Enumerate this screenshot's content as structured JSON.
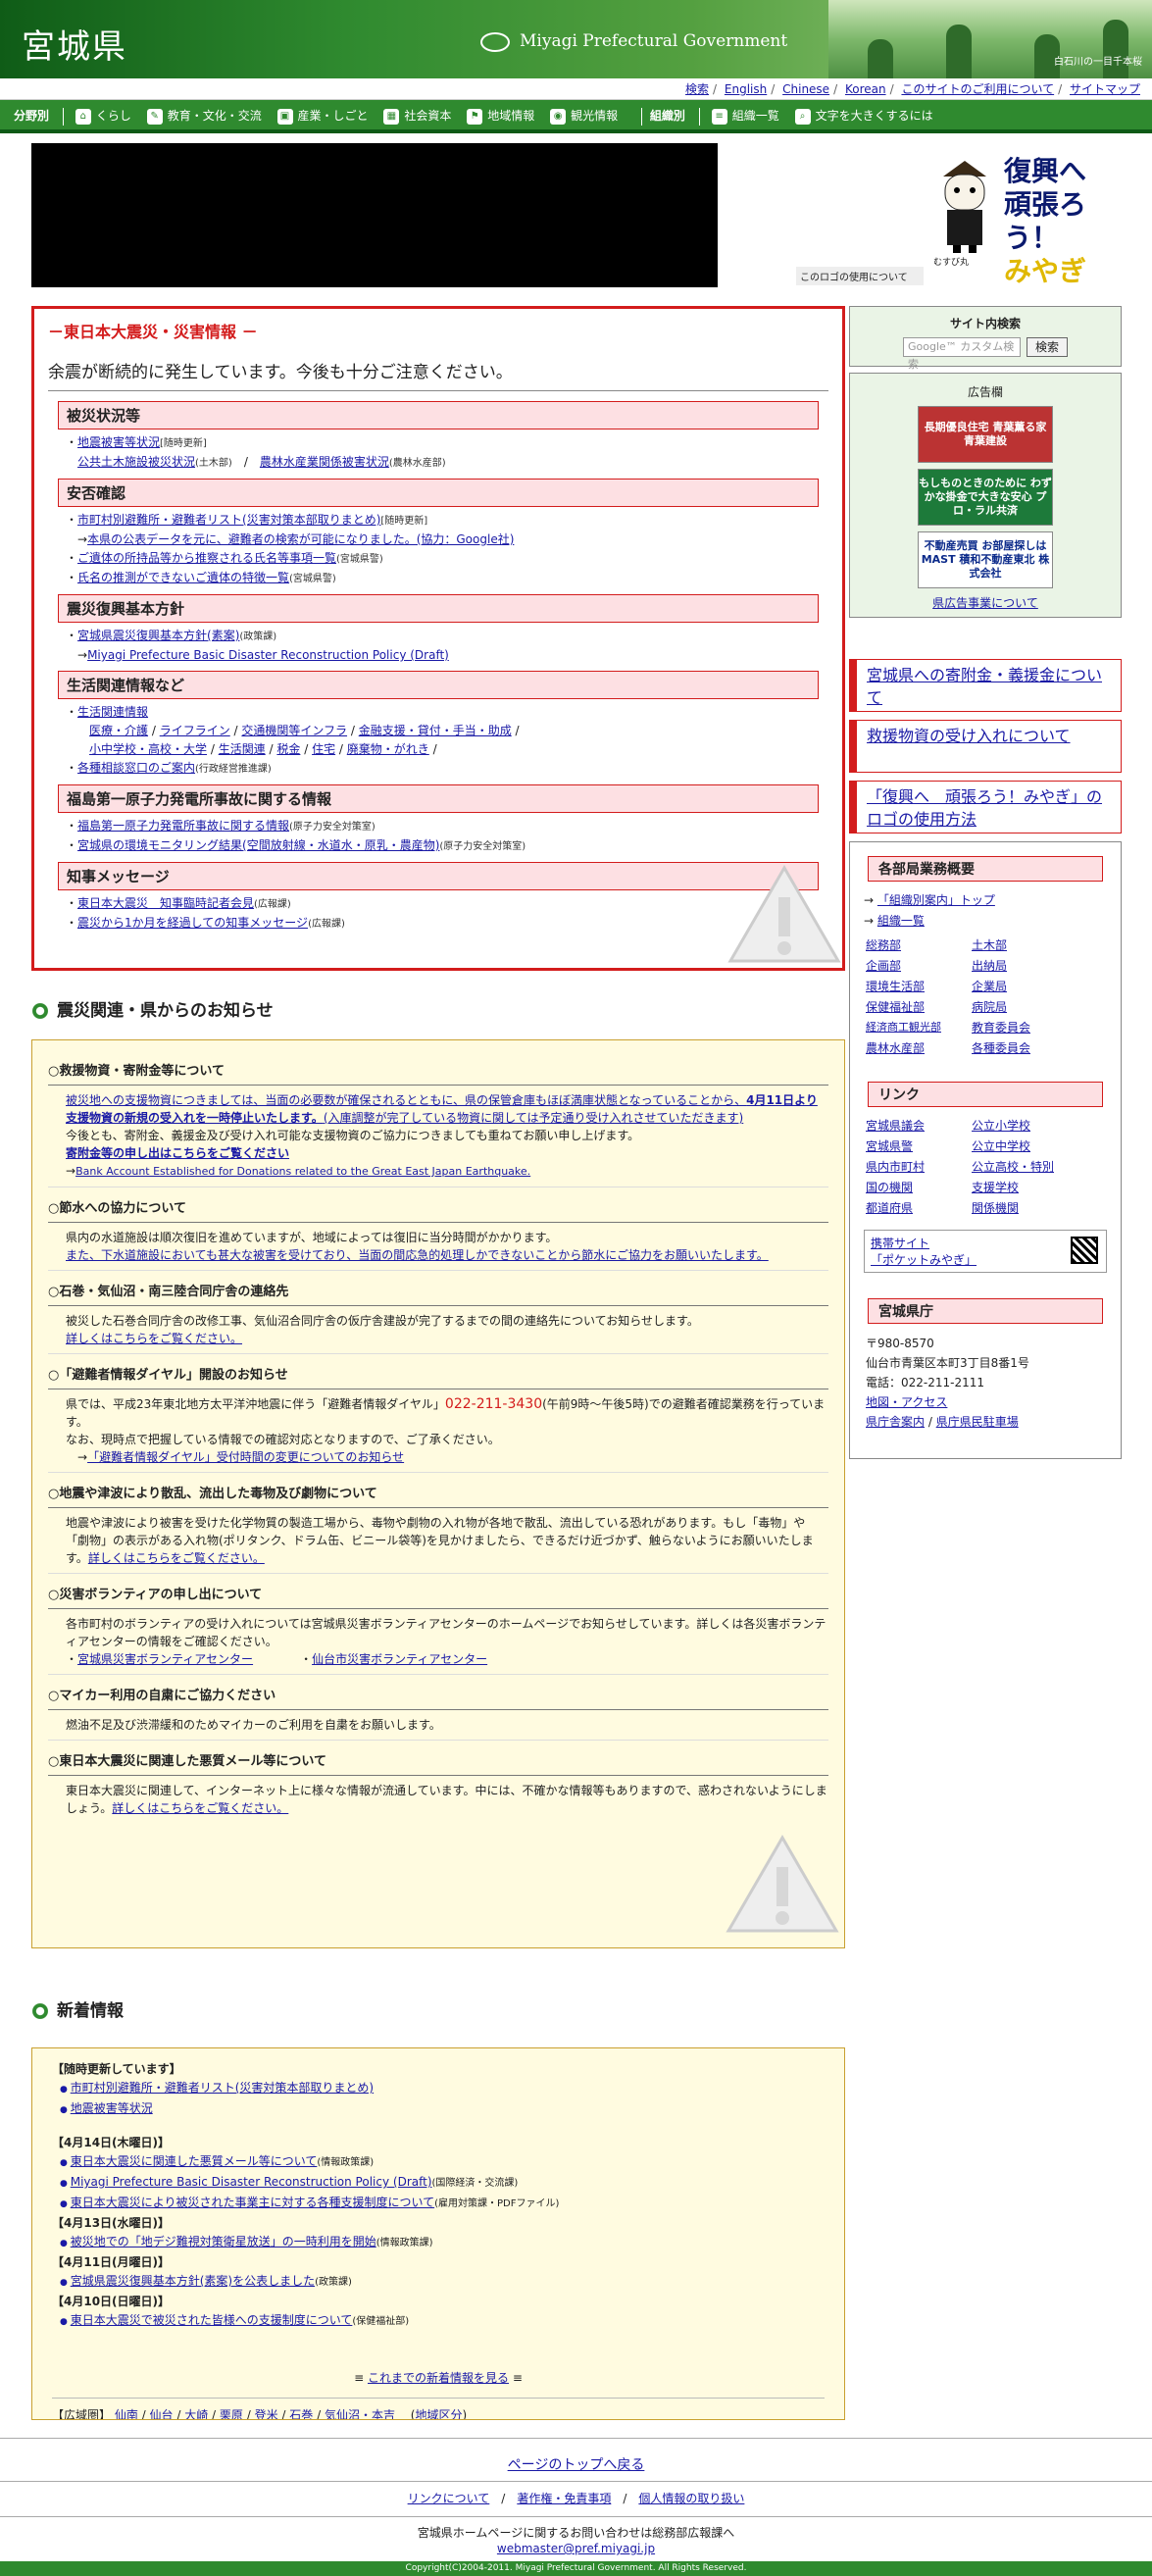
{
  "header": {
    "title": "宮城県",
    "brand": "Miyagi Prefectural Government",
    "caption": "白石川の一目千本桜"
  },
  "util": [
    "検索",
    "English",
    "Chinese",
    "Korean",
    "このサイトのご利用について",
    "サイトマップ"
  ],
  "nav": {
    "bunya": "分野別",
    "items": [
      "くらし",
      "教育・文化・交流",
      "産業・しごと",
      "社会資本",
      "地域情報",
      "観光情報"
    ],
    "soshiki": "組織別",
    "items2": [
      "組織一覧",
      "文字を大きくするには"
    ]
  },
  "logo": {
    "line1": "復興へ",
    "line2": "頑張ろう！",
    "line3": "みやぎ",
    "char": "むすび丸",
    "note": "このロゴの使用について"
  },
  "disaster": {
    "title": "－東日本大震災・災害情報 －",
    "lead": "余震が断続的に発生しています。今後も十分ご注意ください。",
    "s1": "被災状況等",
    "s1a": "地震被害等状況",
    "s1a_n": "[随時更新]",
    "s1b": "公共土木施設被災状況",
    "s1b_n": "(土木部)",
    "s1c": "農林水産業関係被害状況",
    "s1c_n": "(農林水産部)",
    "s2": "安否確認",
    "s2a": "市町村別避難所・避難者リスト(災害対策本部取りまとめ)",
    "s2a_n": "[随時更新]",
    "s2b": "本県の公表データを元に、避難者の検索が可能になりました。(協力：Google社)",
    "s2c": "ご遺体の所持品等から推察される氏名等事項一覧",
    "s2c_n": "(宮城県警)",
    "s2d": "氏名の推測ができないご遺体の特徴一覧",
    "s2d_n": "(宮城県警)",
    "s3": "震災復興基本方針",
    "s3a": "宮城県震災復興基本方針(素案)",
    "s3a_n": "(政策課)",
    "s3b": "Miyagi Prefecture Basic Disaster Reconstruction Policy (Draft)",
    "s4": "生活関連情報など",
    "s4a": "生活関連情報",
    "s4b": [
      "医療・介護",
      "ライフライン",
      "交通機関等インフラ",
      "金融支援・貸付・手当・助成"
    ],
    "s4c": [
      "小中学校・高校・大学",
      "生活関連",
      "税金",
      "住宅",
      "廃棄物・がれき"
    ],
    "s4d": "各種相談窓口のご案内",
    "s4d_n": "(行政経営推進課)",
    "s5": "福島第一原子力発電所事故に関する情報",
    "s5a": "福島第一原子力発電所事故に関する情報",
    "s5a_n": "(原子力安全対策室)",
    "s5b": "宮城県の環境モニタリング結果(空間放射線・水道水・原乳・農産物)",
    "s5b_n": "(原子力安全対策室)",
    "s6": "知事メッセージ",
    "s6a": "東日本大震災　知事臨時記者会見",
    "s6a_n": "(広報課)",
    "s6b": "震災から1か月を経過しての知事メッセージ",
    "s6b_n": "(広報課)"
  },
  "right": {
    "search_title": "サイト内検索",
    "search_ph": "Google™ カスタム検索",
    "search_btn": "検索",
    "ad_title": "広告欄",
    "ads": [
      "長期優良住宅 青葉薫る家 青葉建設",
      "もしものときのために わずかな掛金で大きな安心 プロ・ラル共済",
      "不動産売買 お部屋探しは MAST 積和不動産東北 株式会社"
    ],
    "ad_link": "県広告事業について",
    "red": [
      "宮城県への寄附金・義援金について",
      "救援物資の受け入れについて",
      "「復興へ　頑張ろう！みやぎ」のロゴの使用方法"
    ],
    "dept_hd": "各部局業務概要",
    "dept_a": "「組織別案内」トップ",
    "dept_b": "組織一覧",
    "depts": [
      "総務部",
      "企画部",
      "環境生活部",
      "保健福祉部",
      "経済商工観光部",
      "農林水産部",
      "土木部",
      "出納局",
      "企業局",
      "病院局",
      "教育委員会",
      "各種委員会"
    ],
    "link_hd": "リンク",
    "links": [
      "宮城県議会",
      "宮城県警",
      "県内市町村",
      "国の機関",
      "都道府県",
      "公立小学校",
      "公立中学校",
      "公立高校・特別",
      "支援学校",
      "関係機関"
    ],
    "mob1": "携帯サイト",
    "mob2": "「ポケットみやぎ」",
    "office_hd": "宮城県庁",
    "zip": "〒980-8570",
    "addr": "仙台市青葉区本町3丁目8番1号",
    "tel": "電話：022-211-2111",
    "map": "地図・アクセス",
    "guide": "県庁舎案内",
    "tokyo": "県庁県民駐車場"
  },
  "notice": {
    "title": "震災関連・県からのお知らせ",
    "h1": "○救援物資・寄附金等について",
    "b1a": "被災地への支援物資につきましては、当面の必要数が確保されるとともに、県の保管倉庫もほぼ満庫状態となっていることから、",
    "b1b": "4月11日より支援物資の新規の受入れを一時停止いたします。",
    "b1c": "(入庫調整が完了している物資に関しては予定通り受け入れさせていただきます)",
    "b1d": "今後とも、寄附金、義援金及び受け入れ可能な支援物資のご協力につきましても重ねてお願い申し上げます。",
    "b1e": "寄附金等の申し出はこちらをご覧ください",
    "b1f": "Bank Account Established for Donations related to the Great East Japan Earthquake.",
    "h2": "○節水への協力について",
    "b2a": "県内の水道施設は順次復旧を進めていますが、地域によっては復旧に当分時間がかかります。",
    "b2b": "また、下水道施設においても甚大な被害を受けており、当面の間応急的処理しかできないことから節水にご協力をお願いいたします。",
    "h3": "○石巻・気仙沼・南三陸合同庁舎の連絡先",
    "b3a": "被災した石巻合同庁舎の改修工事、気仙沼合同庁舎の仮庁舎建設が完了するまでの間の連絡先についてお知らせします。",
    "b3b": "詳しくはこちらをご覧ください。",
    "h4": "○「避難者情報ダイヤル」開設のお知らせ",
    "b4a": "県では、平成23年東北地方太平洋沖地震に伴う「避難者情報ダイヤル」",
    "b4tel": "022-211-3430",
    "b4b": "(午前9時～午後5時)での避難者確認業務を行っています。",
    "b4c": "なお、現時点で把握している情報での確認対応となりますので、ご了承ください。",
    "b4d": "「避難者情報ダイヤル」受付時間の変更についてのお知らせ",
    "h5": "○地震や津波により散乱、流出した毒物及び劇物について",
    "b5a": "地震や津波により被害を受けた化学物質の製造工場から、毒物や劇物の入れ物が各地で散乱、流出している恐れがあります。もし「毒物」や「劇物」の表示がある入れ物(ポリタンク、ドラム缶、ビニール袋等)を見かけましたら、できるだけ近づかず、触らないようにお願いいたします。",
    "b5b": "詳しくはこちらをご覧ください。",
    "h6": "○災害ボランティアの申し出について",
    "b6a": "各市町村のボランティアの受け入れについては宮城県災害ボランティアセンターのホームページでお知らせしています。詳しくは各災害ボランティアセンターの情報をご確認ください。",
    "b6b": "宮城県災害ボランティアセンター",
    "b6c": "仙台市災害ボランティアセンター",
    "h7": "○マイカー利用の自粛にご協力ください",
    "b7a": "燃油不足及び渋滞緩和のためマイカーのご利用を自粛をお願いします。",
    "h8": "○東日本大震災に関連した悪質メール等について",
    "b8a": "東日本大震災に関連して、インターネット上に様々な情報が流通しています。中には、不確かな情報等もありますので、惑わされないようにしましょう。",
    "b8b": "詳しくはこちらをご覧ください。"
  },
  "news": {
    "title": "新着情報",
    "g0": "【随時更新しています】",
    "g0i": [
      "市町村別避難所・避難者リスト(災害対策本部取りまとめ)",
      "地震被害等状況"
    ],
    "d1": "【4月14日(木曜日)】",
    "d1i": [
      "東日本大震災に関連した悪質メール等について",
      "Miyagi Prefecture Basic Disaster Reconstruction Policy (Draft)",
      "東日本大震災により被災された事業主に対する各種支援制度について"
    ],
    "d1n": [
      "(情報政策課)",
      "(国際経済・交流課)",
      "(雇用対策課・PDFファイル)"
    ],
    "d2": "【4月13日(水曜日)】",
    "d2i": "被災地での「地デジ難視対策衛星放送」の一時利用を開始",
    "d2n": "(情報政策課)",
    "d3": "【4月11日(月曜日)】",
    "d3i": "宮城県震災復興基本方針(素案)を公表しました",
    "d3n": "(政策課)",
    "d4": "【4月10日(日曜日)】",
    "d4i": "東日本大震災で被災された皆様への支援制度について",
    "d4n": "(保健福祉部)",
    "more": "これまでの新着情報を見る",
    "area_label": "【広域圏】",
    "areas": [
      "仙南",
      "仙台",
      "大崎",
      "栗原",
      "登米",
      "石巻",
      "気仙沼・本吉"
    ],
    "area_sec": "地域区分"
  },
  "footer": {
    "top": "ページのトップへ戻る",
    "l1": "リンクについて",
    "l2": "著作権・免責事項",
    "l3": "個人情報の取り扱い",
    "contact": "宮城県ホームページに関するお問い合わせは総務部広報課へ",
    "mail": "webmaster@pref.miyagi.jp",
    "copy": "Copyright(C)2004-2011. Miyagi Prefectural Government. All Rights Reserved."
  }
}
